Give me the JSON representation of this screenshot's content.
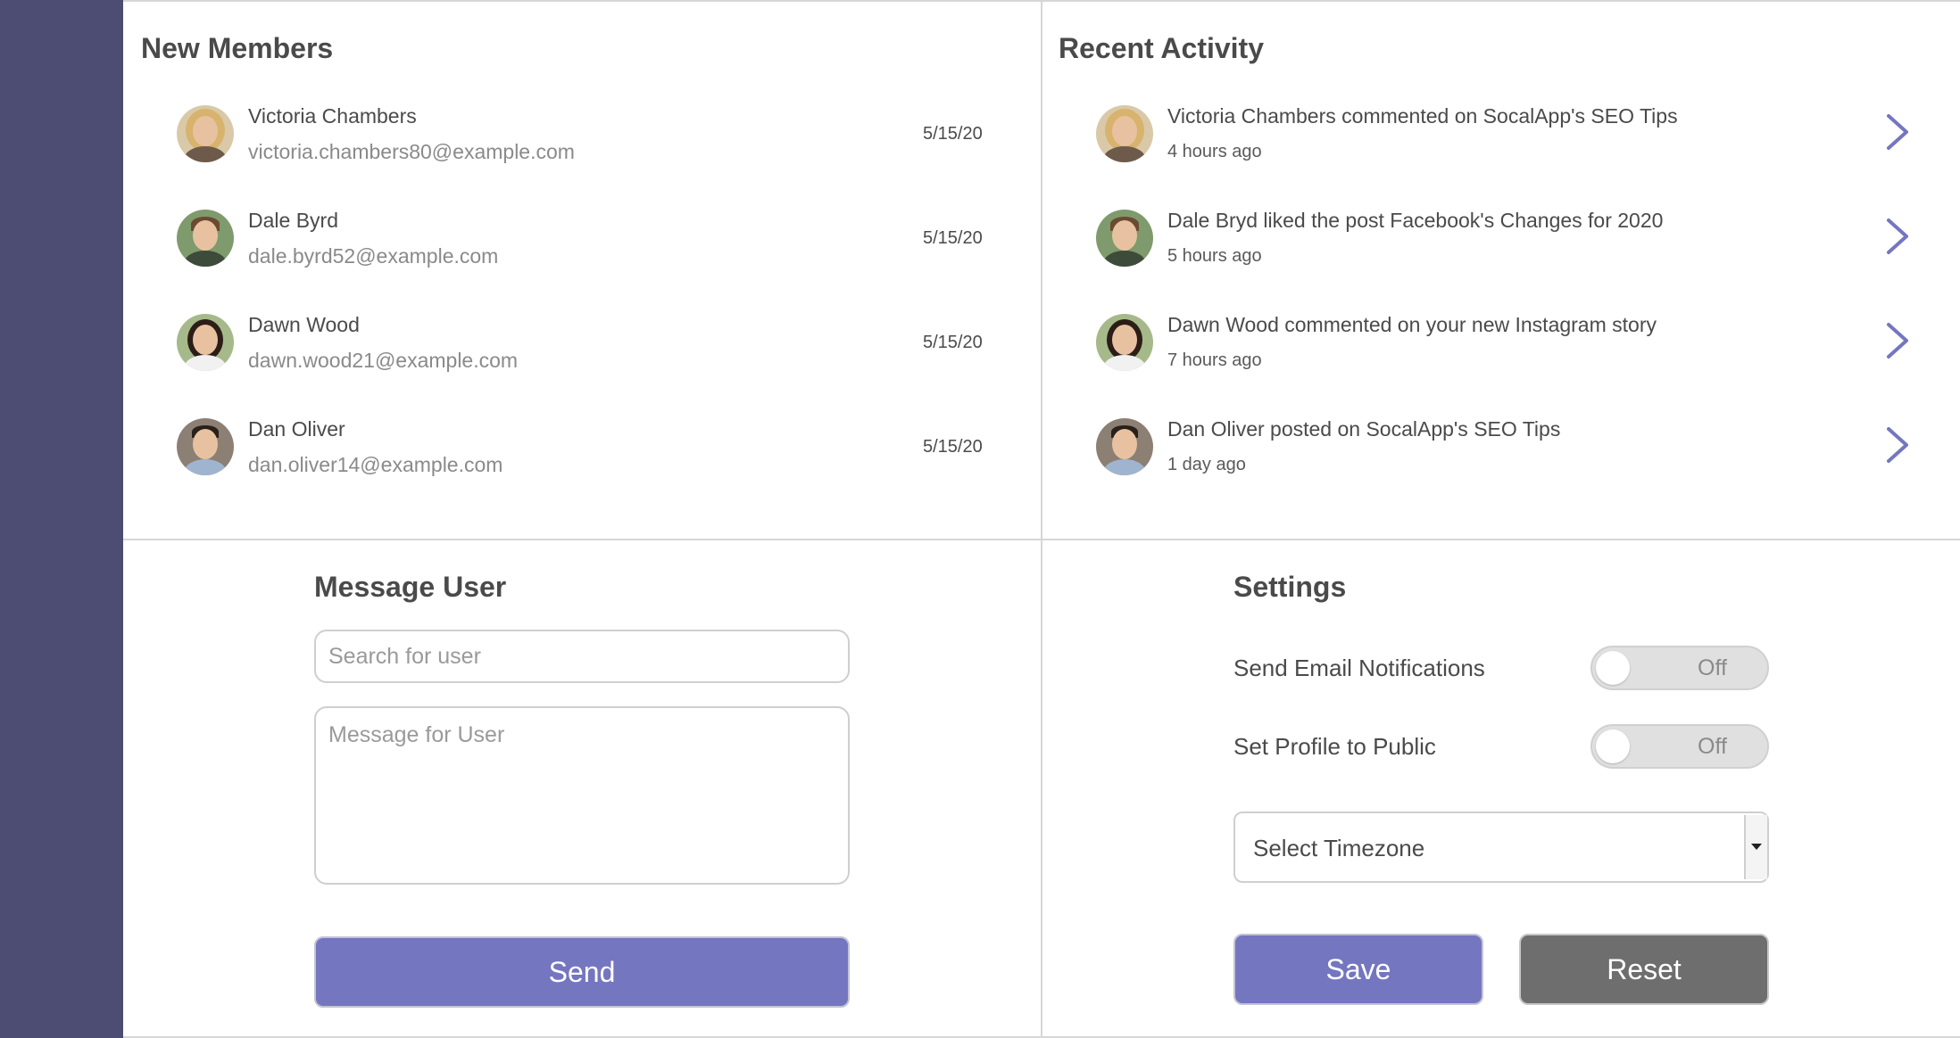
{
  "new_members": {
    "title": "New Members",
    "items": [
      {
        "name": "Victoria Chambers",
        "email": "victoria.chambers80@example.com",
        "date": "5/15/20"
      },
      {
        "name": "Dale Byrd",
        "email": "dale.byrd52@example.com",
        "date": "5/15/20"
      },
      {
        "name": "Dawn Wood",
        "email": "dawn.wood21@example.com",
        "date": "5/15/20"
      },
      {
        "name": "Dan Oliver",
        "email": "dan.oliver14@example.com",
        "date": "5/15/20"
      }
    ]
  },
  "recent_activity": {
    "title": "Recent Activity",
    "items": [
      {
        "text": "Victoria Chambers commented on SocalApp's SEO Tips",
        "time": "4 hours ago"
      },
      {
        "text": "Dale Bryd liked the post Facebook's Changes for 2020",
        "time": "5 hours ago"
      },
      {
        "text": "Dawn Wood commented on your new Instagram story",
        "time": "7 hours ago"
      },
      {
        "text": "Dan Oliver posted on SocalApp's SEO Tips",
        "time": "1 day ago"
      }
    ]
  },
  "message_user": {
    "title": "Message User",
    "search_placeholder": "Search for user",
    "message_placeholder": "Message for User",
    "send_label": "Send"
  },
  "settings": {
    "title": "Settings",
    "email_notifications_label": "Send Email Notifications",
    "email_notifications_state": "Off",
    "public_profile_label": "Set Profile to Public",
    "public_profile_state": "Off",
    "timezone_placeholder": "Select Timezone",
    "save_label": "Save",
    "reset_label": "Reset"
  },
  "colors": {
    "sidebar": "#4d4c72",
    "accent": "#7576c0",
    "chevron": "#7576c0",
    "reset": "#6e6e6e"
  }
}
